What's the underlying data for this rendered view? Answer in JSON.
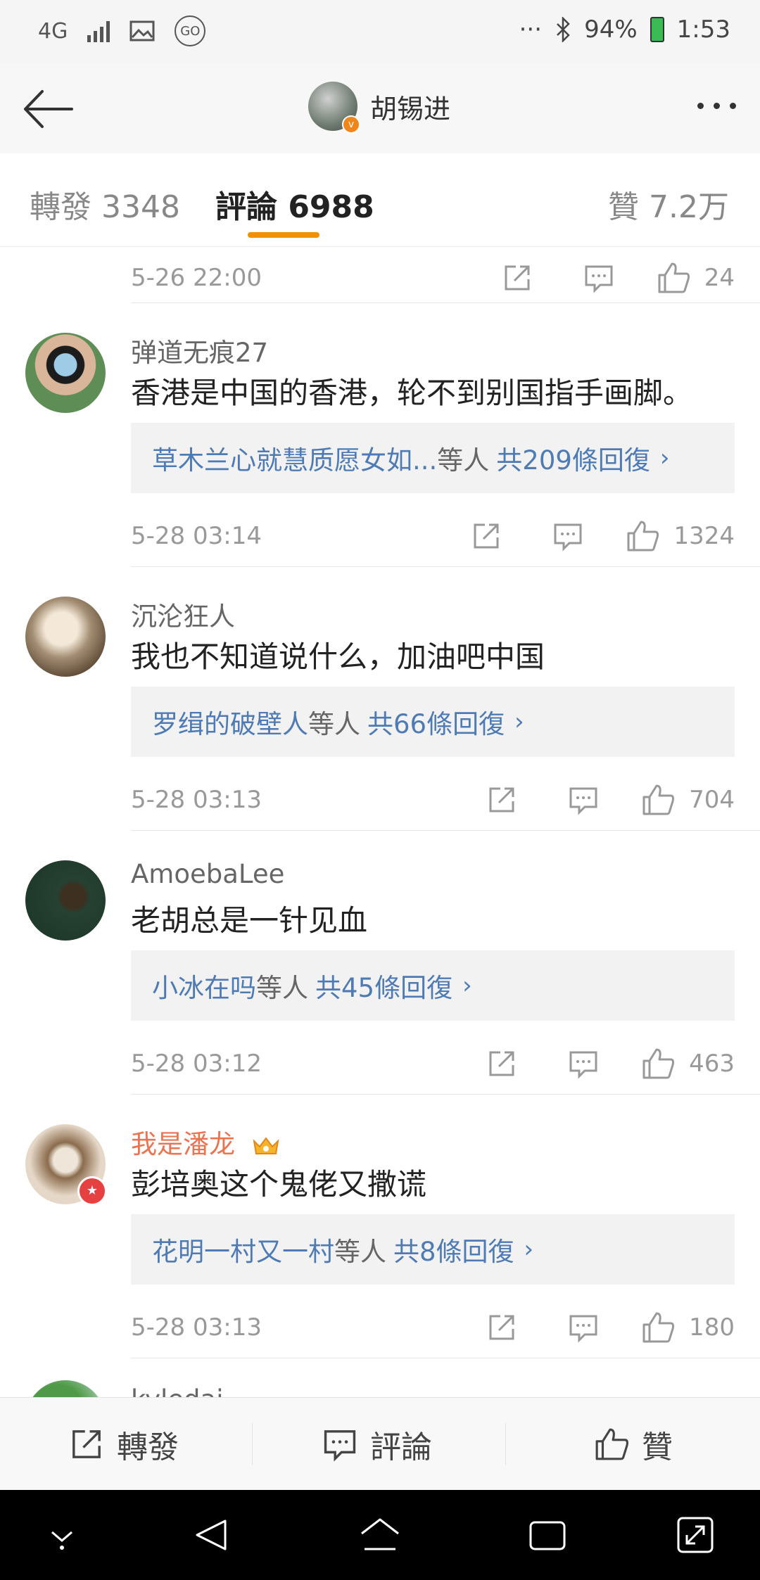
{
  "status_bar": {
    "network": "4G",
    "battery": "94%",
    "time": "1:53",
    "icons": [
      "signal-icon",
      "image-icon",
      "go-icon",
      "more-icon",
      "bluetooth-icon",
      "battery-icon"
    ]
  },
  "header": {
    "title": "胡锡进",
    "back_icon": "back-arrow-icon",
    "more_icon": "more-dots-icon"
  },
  "tabs": [
    {
      "label": "轉發 3348"
    },
    {
      "label": "評論 6988"
    },
    {
      "label": "贊 7.2万"
    }
  ],
  "top_partial": {
    "date": "5-26 22:00",
    "likes": "24"
  },
  "comments": [
    {
      "user": "弹道无痕27",
      "text": "香港是中国的香港，轮不到别国指手画脚。",
      "reply_names": "草木兰心就慧质愿女如...",
      "reply_suffix": "等人",
      "reply_total": "共209條回復",
      "date": "5-28 03:14",
      "likes": "1324"
    },
    {
      "user": "沉沦狂人",
      "text": "我也不知道说什么，加油吧中国",
      "reply_names": "罗缉的破壁人",
      "reply_suffix": "等人",
      "reply_total": "共66條回復",
      "date": "5-28 03:13",
      "likes": "704"
    },
    {
      "user": "AmoebaLee",
      "text": "老胡总是一针见血",
      "reply_names": "小冰在吗",
      "reply_suffix": "等人",
      "reply_total": "共45條回復",
      "date": "5-28 03:12",
      "likes": "463"
    },
    {
      "user": "我是潘龙",
      "text": "彭培奥这个鬼佬又撒谎",
      "reply_names": "花明一村又一村",
      "reply_suffix": "等人",
      "reply_total": "共8條回復",
      "date": "5-28 03:13",
      "likes": "180"
    }
  ],
  "partial_user": "kyledai",
  "bottom_bar": {
    "repost": "轉發",
    "comment": "評論",
    "like": "贊"
  },
  "colors": {
    "accent": "#f29100",
    "link": "#4f7bb4",
    "vip_name": "#eb7350"
  }
}
